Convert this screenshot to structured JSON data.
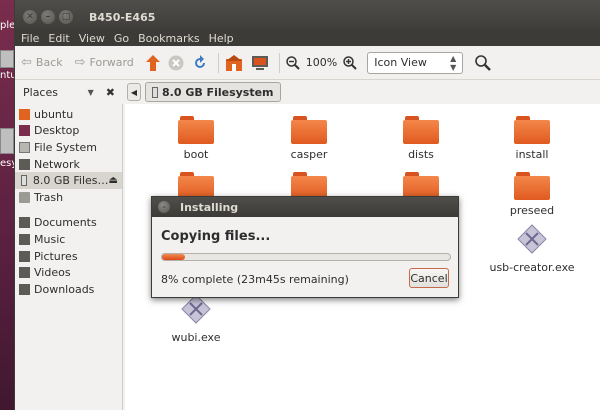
{
  "window": {
    "title": "B450-E465"
  },
  "menu": [
    "File",
    "Edit",
    "View",
    "Go",
    "Bookmarks",
    "Help"
  ],
  "toolbar": {
    "back_label": "Back",
    "forward_label": "Forward",
    "zoom_value": "100%",
    "view_mode": "Icon View"
  },
  "location": {
    "places_label": "Places",
    "current_path": "8.0 GB Filesystem"
  },
  "sidebar": {
    "group1": [
      "ubuntu",
      "Desktop",
      "File System",
      "Network",
      "8.0 GB Files…",
      "Trash"
    ],
    "group2": [
      "Documents",
      "Music",
      "Pictures",
      "Videos",
      "Downloads"
    ]
  },
  "files": [
    "boot",
    "casper",
    "dists",
    "install",
    "preseed",
    "usb-creator.exe",
    "wubi.exe"
  ],
  "dialog": {
    "title": "Installing",
    "heading": "Copying files...",
    "progress_percent": 8,
    "status": "8% complete (23m45s remaining)",
    "cancel_label": "Cancel"
  },
  "desktop": {
    "label_top": "ple",
    "label_mid": "esy",
    "label_side": "ntu"
  },
  "colors": {
    "accent": "#dd4814",
    "titlebar": "#3c3b37",
    "folder": "#f07746"
  }
}
